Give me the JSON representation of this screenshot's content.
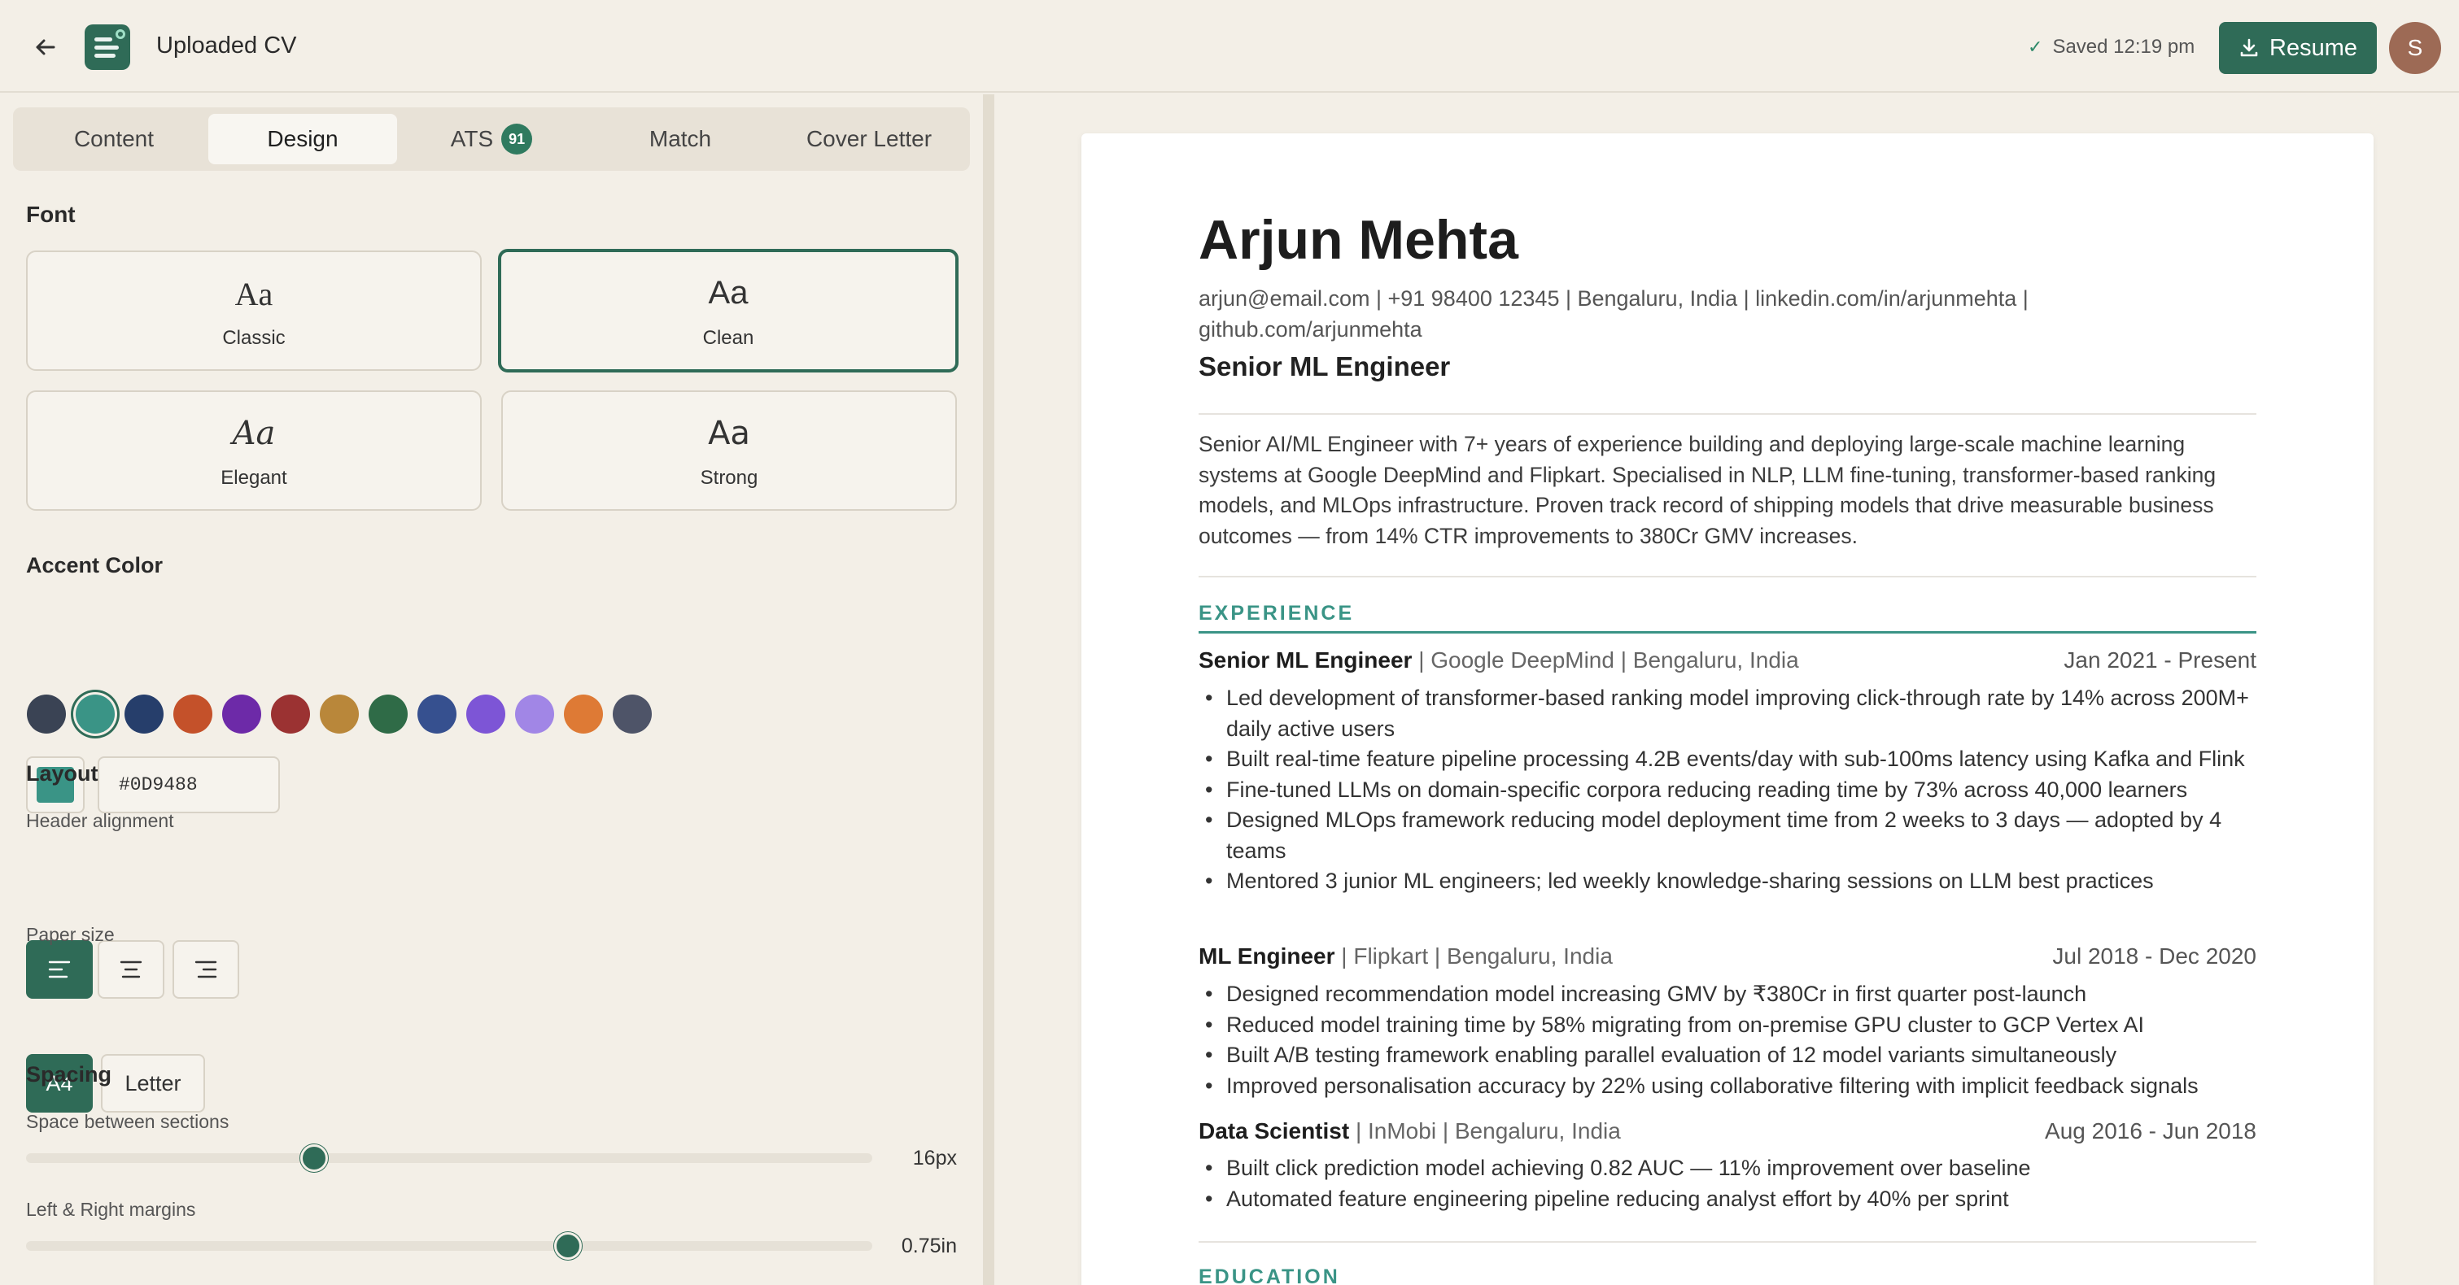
{
  "header": {
    "title": "Uploaded CV",
    "saved_text": "Saved 12:19 pm",
    "resume_button": "Resume",
    "avatar_initial": "S",
    "brand_color": "#2f6b57"
  },
  "tabs": [
    {
      "label": "Content"
    },
    {
      "label": "Design",
      "active": true
    },
    {
      "label": "ATS",
      "badge": "91"
    },
    {
      "label": "Match"
    },
    {
      "label": "Cover Letter"
    }
  ],
  "design": {
    "font_title": "Font",
    "fonts": [
      {
        "sample": "Aa",
        "name": "Classic"
      },
      {
        "sample": "Aa",
        "name": "Clean",
        "selected": true
      },
      {
        "sample": "Aa",
        "name": "Elegant"
      },
      {
        "sample": "Aa",
        "name": "Strong"
      }
    ],
    "accent_title": "Accent Color",
    "swatches": [
      "#3a4354",
      "#3a9486",
      "#263e6b",
      "#c4512a",
      "#6d2aa8",
      "#9b3232",
      "#b9873a",
      "#2f6b47",
      "#36508f",
      "#7d55d6",
      "#a186e6",
      "#de7a35",
      "#4e5468"
    ],
    "selected_swatch": 1,
    "hex_value": "#0D9488",
    "layout_title": "Layout",
    "header_alignment_label": "Header alignment",
    "paper_size_label": "Paper size",
    "paper_sizes": [
      "A4",
      "Letter"
    ],
    "spacing_title": "Spacing",
    "section_space_label": "Space between sections",
    "section_space_value": "16px",
    "section_space_fraction": 0.34,
    "margins_label": "Left & Right margins",
    "margins_value": "0.75in",
    "margins_fraction": 0.64
  },
  "resume": {
    "accent": "#3a9486",
    "name": "Arjun Mehta",
    "contact": "arjun@email.com | +91 98400 12345 | Bengaluru, India | linkedin.com/in/arjunmehta | github.com/arjunmehta",
    "role": "Senior ML Engineer",
    "summary": "Senior AI/ML Engineer with 7+ years of experience building and deploying large-scale machine learning systems at Google DeepMind and Flipkart. Specialised in NLP, LLM fine-tuning, transformer-based ranking models, and MLOps infrastructure. Proven track record of shipping models that drive measurable business outcomes — from 14% CTR improvements to 380Cr GMV increases.",
    "experience_title": "EXPERIENCE",
    "jobs": [
      {
        "title": "Senior ML Engineer",
        "meta": " | Google DeepMind | Bengaluru, India",
        "dates": "Jan 2021 - Present",
        "bullets": [
          "Led development of transformer-based ranking model improving click-through rate by 14% across 200M+ daily active users",
          "Built real-time feature pipeline processing 4.2B events/day with sub-100ms latency using Kafka and Flink",
          "Fine-tuned LLMs on domain-specific corpora reducing reading time by 73% across 40,000 learners",
          "Designed MLOps framework reducing model deployment time from 2 weeks to 3 days — adopted by 4 teams",
          "Mentored 3 junior ML engineers; led weekly knowledge-sharing sessions on LLM best practices"
        ]
      },
      {
        "title": "ML Engineer",
        "meta": " | Flipkart | Bengaluru, India",
        "dates": "Jul 2018 - Dec 2020",
        "bullets": [
          "Designed recommendation model increasing GMV by ₹380Cr in first quarter post-launch",
          "Reduced model training time by 58% migrating from on-premise GPU cluster to GCP Vertex AI",
          "Built A/B testing framework enabling parallel evaluation of 12 model variants simultaneously",
          "Improved personalisation accuracy by 22% using collaborative filtering with implicit feedback signals"
        ]
      },
      {
        "title": "Data Scientist",
        "meta": " | InMobi | Bengaluru, India",
        "dates": "Aug 2016 - Jun 2018",
        "bullets": [
          "Built click prediction model achieving 0.82 AUC — 11% improvement over baseline",
          "Automated feature engineering pipeline reducing analyst effort by 40% per sprint"
        ]
      }
    ],
    "education_title": "EDUCATION"
  }
}
